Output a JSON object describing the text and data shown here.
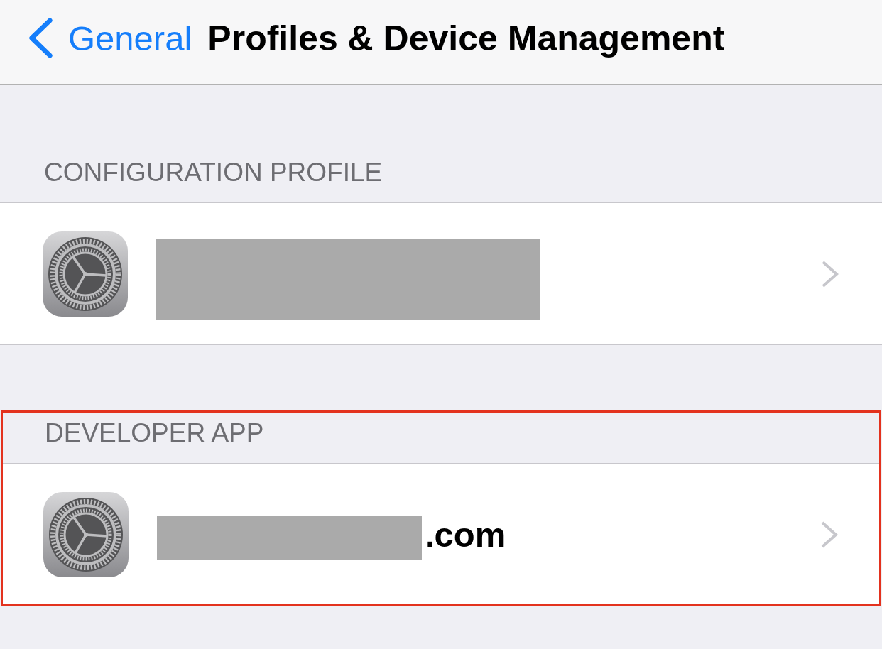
{
  "nav_bar": {
    "back_label": "General",
    "title": "Profiles & Device Management"
  },
  "sections": [
    {
      "header": "CONFIGURATION PROFILE",
      "highlighted": false,
      "rows": [
        {
          "kind": "redacted"
        }
      ]
    },
    {
      "header": "DEVELOPER APP",
      "highlighted": true,
      "rows": [
        {
          "kind": "partial",
          "title": ".com"
        }
      ]
    }
  ]
}
